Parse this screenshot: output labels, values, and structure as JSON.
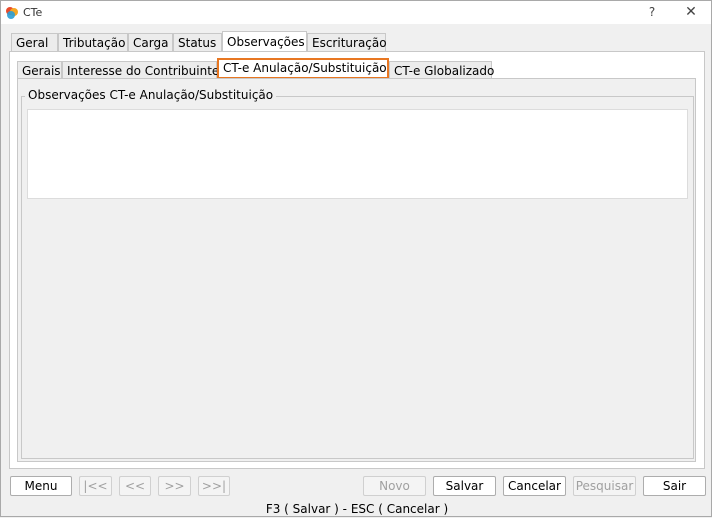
{
  "window": {
    "title": "CTe",
    "help_symbol": "?",
    "close_symbol": "✕",
    "icon": "app-logo-icon"
  },
  "main_tabs": [
    {
      "label": "Geral"
    },
    {
      "label": "Tributação"
    },
    {
      "label": "Carga"
    },
    {
      "label": "Status"
    },
    {
      "label": "Observações",
      "active": true
    },
    {
      "label": "Escrituração"
    }
  ],
  "sub_tabs": [
    {
      "label": "Gerais"
    },
    {
      "label": "Interesse do Contribuinte"
    },
    {
      "label": "CT-e Anulação/Substituição",
      "active": true
    },
    {
      "label": "CT-e Globalizado"
    }
  ],
  "observations": {
    "legend": "Observações CT-e Anulação/Substituição",
    "value": ""
  },
  "buttons": {
    "menu": "Menu",
    "first": "|<<",
    "prev": "<<",
    "next": ">>",
    "last": ">>|",
    "novo": "Novo",
    "salvar": "Salvar",
    "cancelar": "Cancelar",
    "pesquisar": "Pesquisar",
    "sair": "Sair"
  },
  "status_bar": "F3 ( Salvar )  -  ESC ( Cancelar )",
  "colors": {
    "highlight_border": "#e87722",
    "disabled_text": "#a0a0a0"
  }
}
